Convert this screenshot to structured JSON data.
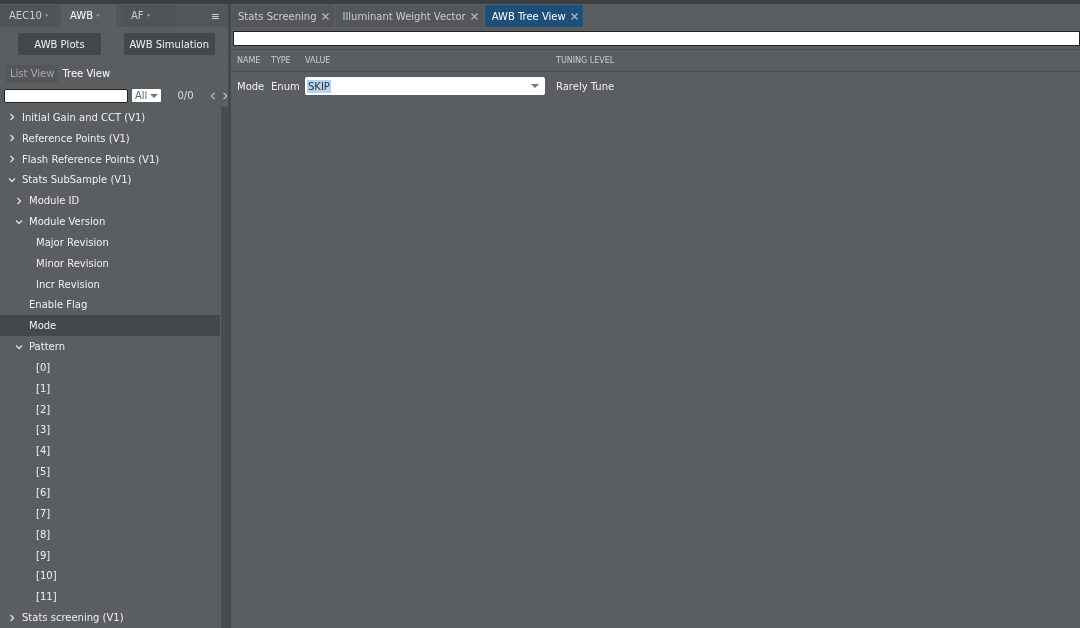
{
  "left_tabs": [
    {
      "label": "AEC10",
      "pin": "ᵠ",
      "selected": false
    },
    {
      "label": "AWB",
      "pin": "ᵠ",
      "selected": true
    },
    {
      "label": "AF",
      "pin": "ᵠ",
      "selected": false
    }
  ],
  "menu_glyph": "≡",
  "buttons": [
    "AWB Plots",
    "AWB Simulation"
  ],
  "view_toggle": [
    {
      "label": "List View",
      "selected": false
    },
    {
      "label": "Tree View",
      "selected": true
    }
  ],
  "filter": {
    "scope": "All",
    "count": "0/0"
  },
  "tree": [
    {
      "label": "Initial Gain and CCT (V1)",
      "expanded": false,
      "selected": false
    },
    {
      "label": "Reference Points (V1)",
      "expanded": false,
      "selected": false
    },
    {
      "label": "Flash Reference Points (V1)",
      "expanded": false,
      "selected": false
    },
    {
      "label": "Stats SubSample (V1)",
      "expanded": true,
      "selected": false,
      "children": [
        {
          "label": "Module ID",
          "expanded": false,
          "selected": false
        },
        {
          "label": "Module Version",
          "expanded": true,
          "selected": false,
          "children": [
            {
              "label": "Major Revision",
              "selected": false
            },
            {
              "label": "Minor Revision",
              "selected": false
            },
            {
              "label": "Incr Revision",
              "selected": false
            }
          ]
        },
        {
          "label": "Enable Flag",
          "selected": false
        },
        {
          "label": "Mode",
          "selected": true
        },
        {
          "label": "Pattern",
          "expanded": true,
          "selected": false,
          "children": [
            {
              "label": "[0]",
              "selected": false
            },
            {
              "label": "[1]",
              "selected": false
            },
            {
              "label": "[2]",
              "selected": false
            },
            {
              "label": "[3]",
              "selected": false
            },
            {
              "label": "[4]",
              "selected": false
            },
            {
              "label": "[5]",
              "selected": false
            },
            {
              "label": "[6]",
              "selected": false
            },
            {
              "label": "[7]",
              "selected": false
            },
            {
              "label": "[8]",
              "selected": false
            },
            {
              "label": "[9]",
              "selected": false
            },
            {
              "label": "[10]",
              "selected": false
            },
            {
              "label": "[11]",
              "selected": false
            }
          ]
        }
      ]
    },
    {
      "label": "Stats screening (V1)",
      "expanded": false,
      "selected": false
    }
  ],
  "doc_tabs": [
    {
      "label": "Stats Screening",
      "selected": false
    },
    {
      "label": "Illuminant Weight Vector",
      "selected": false
    },
    {
      "label": "AWB Tree View",
      "selected": true
    }
  ],
  "table": {
    "columns": [
      "NAME",
      "TYPE",
      "VALUE",
      "TUNING LEVEL"
    ],
    "rows": [
      {
        "name": "Mode",
        "type": "Enum",
        "value": "SKIP",
        "value_highlighted": true,
        "tuning_level": "Rarely Tune"
      }
    ]
  }
}
